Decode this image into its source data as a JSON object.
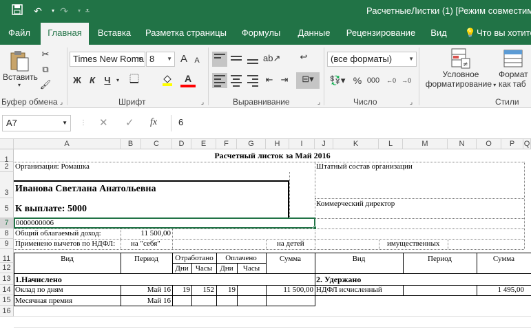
{
  "window": {
    "title": "РасчетныеЛистки (1)  [Режим совместимо",
    "icons": [
      "save-icon",
      "undo-icon",
      "redo-icon",
      "customize-icon"
    ]
  },
  "tabs": [
    {
      "label": "Файл"
    },
    {
      "label": "Главная"
    },
    {
      "label": "Вставка"
    },
    {
      "label": "Разметка страницы"
    },
    {
      "label": "Формулы"
    },
    {
      "label": "Данные"
    },
    {
      "label": "Рецензирование"
    },
    {
      "label": "Вид"
    },
    {
      "label": "Что вы хотите"
    }
  ],
  "ribbon": {
    "clipboard": {
      "paste_label": "Вставить",
      "group_label": "Буфер обмена"
    },
    "font": {
      "name": "Times New Roma",
      "size": "8",
      "bold": "Ж",
      "italic": "К",
      "underline": "Ч",
      "grow": "A",
      "shrink": "A",
      "color_letter": "A",
      "group_label": "Шрифт"
    },
    "alignment": {
      "group_label": "Выравнивание"
    },
    "number": {
      "format": "(все форматы)",
      "percent": "%",
      "thousands": "000",
      "group_label": "Число"
    },
    "styles": {
      "conditional_line1": "Условное",
      "conditional_line2": "форматирование",
      "table_line1": "Формат",
      "table_line2": "как таб",
      "group_label": "Стили"
    }
  },
  "formula_bar": {
    "name_box": "A7",
    "fx": "fx",
    "value": "6"
  },
  "grid": {
    "columns": [
      "A",
      "B",
      "C",
      "D",
      "E",
      "F",
      "G",
      "H",
      "I",
      "J",
      "K",
      "L",
      "M",
      "N",
      "O",
      "P",
      "Q"
    ],
    "rows": [
      "1",
      "2",
      "3",
      "5",
      "7",
      "8",
      "9",
      "11",
      "12",
      "13",
      "14",
      "15",
      "16"
    ]
  },
  "sheet": {
    "title": "Расчетный листок за Май 2016",
    "org": "Организация: Ромашка",
    "staff": "Штатный состав организации",
    "name": "Иванова Светлана Анатольевна",
    "payout": "К выплате: 5000",
    "position": "Коммерческий директор",
    "tab_number": "0000000006",
    "income_label": "Общий облагаемый доход:",
    "income_value": "11 500,00",
    "deductions_label": "Применено вычетов по НДФЛ:",
    "ded_self": "на \"себя\"",
    "ded_children": "на детей",
    "ded_property": "имущественных",
    "hdr_kind": "Вид",
    "hdr_period": "Период",
    "hdr_worked": "Отработано",
    "hdr_paid": "Оплачено",
    "hdr_sum": "Сумма",
    "hdr_days": "Дни",
    "hdr_hours": "Часы",
    "sec_accrued": "1.Начислено",
    "sec_withheld": "2. Удержано",
    "rows": [
      {
        "kind": "Оклад по дням",
        "period": "Май 16",
        "w_days": "19",
        "w_hours": "152",
        "p_days": "19",
        "sum": "11 500,00",
        "w_kind": "НДФЛ исчисленный",
        "w_sum": "1 495,00"
      },
      {
        "kind": "Месячная премия",
        "period": "Май 16"
      }
    ]
  }
}
